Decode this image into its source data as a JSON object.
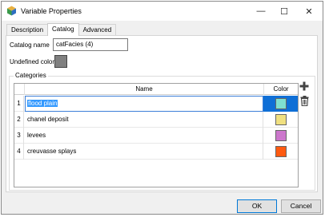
{
  "window": {
    "title": "Variable Properties",
    "controls": {
      "minimize": "—",
      "maximize": "☐",
      "close": "✕"
    }
  },
  "tabs": [
    {
      "label": "Description",
      "active": false
    },
    {
      "label": "Catalog",
      "active": true
    },
    {
      "label": "Advanced",
      "active": false
    }
  ],
  "catalog": {
    "name_label": "Catalog name",
    "name_value": "catFacies (4)",
    "undefined_color_label": "Undefined color",
    "undefined_color": "#808080"
  },
  "categories": {
    "group_title": "Categories",
    "columns": {
      "name": "Name",
      "color": "Color"
    },
    "rows": [
      {
        "num": "1",
        "name": "flood plain",
        "color": "#7fe0d0",
        "selected": true
      },
      {
        "num": "2",
        "name": "chanel deposit",
        "color": "#f0e080"
      },
      {
        "num": "3",
        "name": "levees",
        "color": "#cc77cc"
      },
      {
        "num": "4",
        "name": "creuvasse splays",
        "color": "#ff5a10"
      }
    ]
  },
  "icons": {
    "add": "plus-icon",
    "delete": "trash-icon"
  },
  "footer": {
    "ok_label": "OK",
    "cancel_label": "Cancel"
  }
}
